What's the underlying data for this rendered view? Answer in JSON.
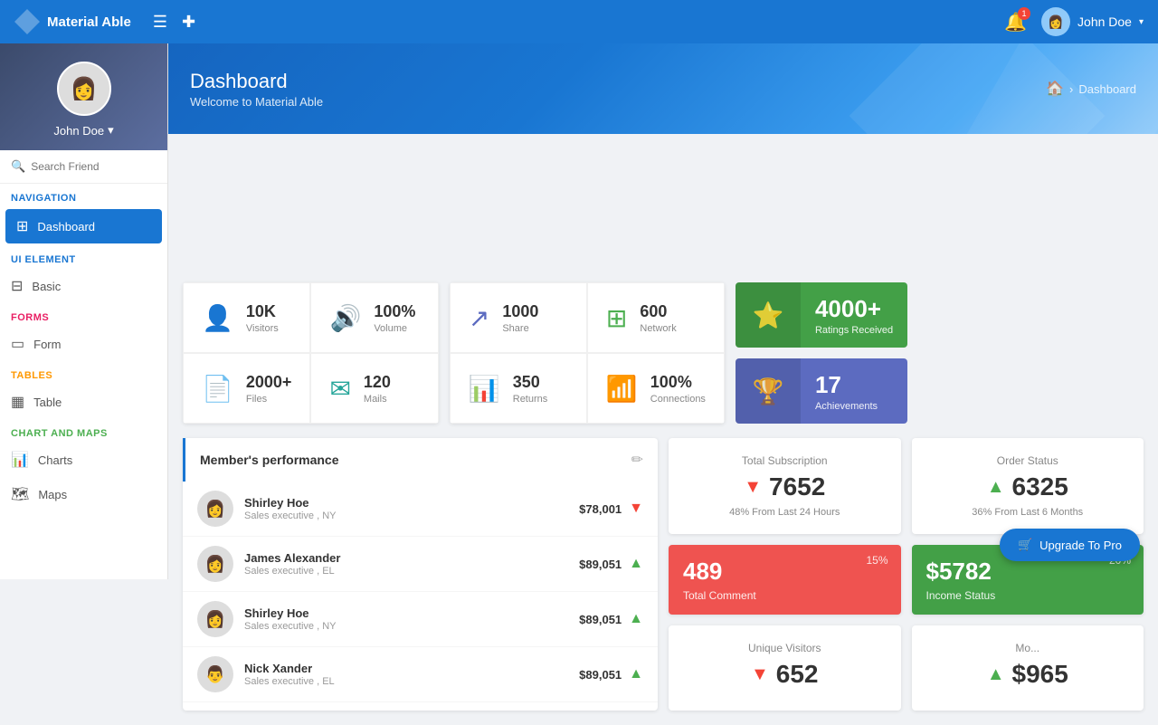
{
  "app": {
    "name": "Material Able"
  },
  "topnav": {
    "logo": "Material Able",
    "user_name": "John Doe",
    "bell_badge": "1"
  },
  "sidebar": {
    "username": "John Doe",
    "search_placeholder": "Search Friend",
    "sections": [
      {
        "label": "Navigation",
        "color": "blue",
        "items": [
          {
            "icon": "⊞",
            "label": "Dashboard",
            "active": true
          }
        ]
      },
      {
        "label": "UI Element",
        "color": "blue",
        "items": [
          {
            "icon": "⊟",
            "label": "Basic"
          }
        ]
      },
      {
        "label": "Forms",
        "color": "pink",
        "items": [
          {
            "icon": "▭",
            "label": "Form"
          }
        ]
      },
      {
        "label": "Tables",
        "color": "orange",
        "items": [
          {
            "icon": "▦",
            "label": "Table"
          }
        ]
      },
      {
        "label": "Chart And Maps",
        "color": "green",
        "items": [
          {
            "icon": "📊",
            "label": "Charts"
          },
          {
            "icon": "🗺",
            "label": "Maps"
          }
        ]
      }
    ]
  },
  "header": {
    "title": "Dashboard",
    "subtitle": "Welcome to Material Able",
    "breadcrumb": "Dashboard"
  },
  "stats_row1": [
    {
      "icon": "👤",
      "icon_color": "blue",
      "value": "10K",
      "label": "Visitors"
    },
    {
      "icon": "🔊",
      "icon_color": "green",
      "value": "100%",
      "label": "Volume"
    },
    {
      "icon": "↗",
      "icon_color": "blue",
      "value": "1000",
      "label": "Share"
    },
    {
      "icon": "⊞",
      "icon_color": "green",
      "value": "600",
      "label": "Network"
    }
  ],
  "stats_row2": [
    {
      "icon": "📄",
      "icon_color": "orange",
      "value": "2000+",
      "label": "Files"
    },
    {
      "icon": "✉",
      "icon_color": "teal",
      "value": "120",
      "label": "Mails"
    },
    {
      "icon": "📊",
      "icon_color": "red",
      "value": "350",
      "label": "Returns"
    },
    {
      "icon": "📶",
      "icon_color": "cyan",
      "value": "100%",
      "label": "Connections"
    }
  ],
  "stat_cards_special": [
    {
      "bg": "green",
      "icon": "⭐",
      "value": "4000+",
      "label": "Ratings Received"
    },
    {
      "bg": "blue",
      "icon": "🏆",
      "value": "17",
      "label": "Achievements"
    }
  ],
  "members_panel": {
    "title": "Member's performance",
    "members": [
      {
        "name": "Shirley Hoe",
        "role": "Sales executive , NY",
        "amount": "$78,001",
        "trend": "down"
      },
      {
        "name": "James Alexander",
        "role": "Sales executive , EL",
        "amount": "$89,051",
        "trend": "up"
      },
      {
        "name": "Shirley Hoe",
        "role": "Sales executive , NY",
        "amount": "$89,051",
        "trend": "up"
      },
      {
        "name": "Nick Xander",
        "role": "Sales executive , EL",
        "amount": "$89,051",
        "trend": "up"
      }
    ]
  },
  "widgets": {
    "total_subscription": {
      "label": "Total Subscription",
      "value": "7652",
      "sub": "48% From Last 24 Hours",
      "trend": "down"
    },
    "order_status": {
      "label": "Order Status",
      "value": "6325",
      "sub": "36% From Last 6 Months",
      "trend": "up"
    },
    "total_comment": {
      "value": "489",
      "label": "Total Comment",
      "pct": "15%",
      "bg": "red"
    },
    "income_status": {
      "value": "$5782",
      "label": "Income Status",
      "pct": "20%",
      "bg": "green"
    },
    "unique_visitors": {
      "label": "Unique Visitors",
      "value": "652",
      "trend": "down"
    },
    "more": {
      "label": "Mo...",
      "value": "$965",
      "trend": "up"
    }
  },
  "upgrade_btn": "Upgrade To Pro"
}
